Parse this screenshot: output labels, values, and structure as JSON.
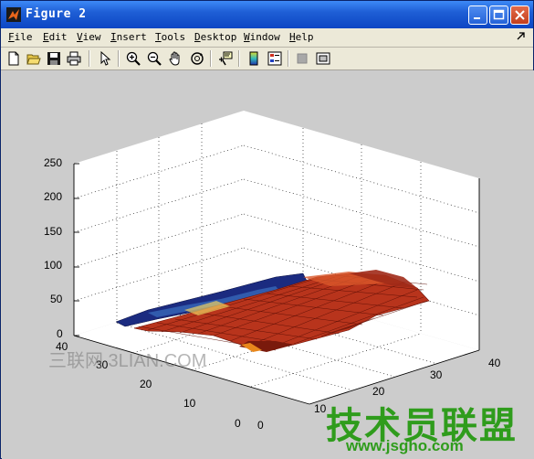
{
  "window": {
    "title": "Figure 2",
    "titlebar_color": "#1f5fd6"
  },
  "menubar": {
    "items": [
      {
        "label": "File",
        "accel": "F"
      },
      {
        "label": "Edit",
        "accel": "E"
      },
      {
        "label": "View",
        "accel": "V"
      },
      {
        "label": "Insert",
        "accel": "I"
      },
      {
        "label": "Tools",
        "accel": "T"
      },
      {
        "label": "Desktop",
        "accel": "D"
      },
      {
        "label": "Window",
        "accel": "W"
      },
      {
        "label": "Help",
        "accel": "H"
      }
    ]
  },
  "toolbar": {
    "buttons": [
      "new-figure-icon",
      "open-file-icon",
      "save-icon",
      "print-icon",
      "edit-plot-arrow-icon",
      "zoom-in-icon",
      "zoom-out-icon",
      "pan-hand-icon",
      "rotate-3d-icon",
      "data-cursor-icon",
      "colorbar-icon",
      "legend-icon",
      "hide-plot-tools-icon",
      "show-plot-tools-icon"
    ]
  },
  "axes": {
    "z_ticks": [
      "250",
      "200",
      "150",
      "100",
      "50",
      "0"
    ],
    "y_ticks": [
      "40",
      "30",
      "20",
      "10",
      "0"
    ],
    "x_ticks": [
      "0",
      "10",
      "20",
      "30",
      "40"
    ]
  },
  "watermarks": {
    "left": "三联网 3LIAN.COM",
    "right_big": "技术员联盟",
    "right_small": "www.jsgho.com"
  },
  "colors": {
    "surface_main": "#b8341c",
    "surface_low": "#7a1a0c",
    "surface_high": "#e8871c",
    "surface_back": "#1a2a7a",
    "figure_bg": "#cccccc",
    "axes_bg": "#ffffff"
  }
}
